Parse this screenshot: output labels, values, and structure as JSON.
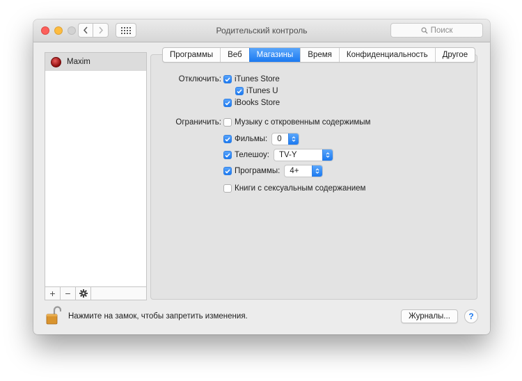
{
  "window": {
    "title": "Родительский контроль",
    "search_placeholder": "Поиск"
  },
  "sidebar": {
    "users": [
      {
        "name": "Maxim"
      }
    ],
    "footer": {
      "add": "+",
      "remove": "−"
    }
  },
  "tabs": [
    {
      "label": "Программы",
      "active": false
    },
    {
      "label": "Веб",
      "active": false
    },
    {
      "label": "Магазины",
      "active": true
    },
    {
      "label": "Время",
      "active": false
    },
    {
      "label": "Конфиденциальность",
      "active": false
    },
    {
      "label": "Другое",
      "active": false
    }
  ],
  "disable": {
    "label": "Отключить:",
    "items": [
      {
        "label": "iTunes Store",
        "checked": true
      },
      {
        "label": "iTunes U",
        "checked": true
      },
      {
        "label": "iBooks Store",
        "checked": true
      }
    ]
  },
  "restrict": {
    "label": "Ограничить:",
    "explicit_music": {
      "label": "Музыку с откровенным содержимым",
      "checked": false
    },
    "movies": {
      "label": "Фильмы:",
      "checked": true,
      "value": "0"
    },
    "tv": {
      "label": "Телешоу:",
      "checked": true,
      "value": "TV-Y"
    },
    "apps": {
      "label": "Программы:",
      "checked": true,
      "value": "4+"
    },
    "books": {
      "label": "Книги с сексуальным содержанием",
      "checked": false
    }
  },
  "footer": {
    "lock_text": "Нажмите на замок, чтобы запретить изменения.",
    "logs_button": "Журналы...",
    "help": "?"
  },
  "colors": {
    "accent": "#1b79f0",
    "close": "#fc605c",
    "minimize": "#fdbc40"
  }
}
